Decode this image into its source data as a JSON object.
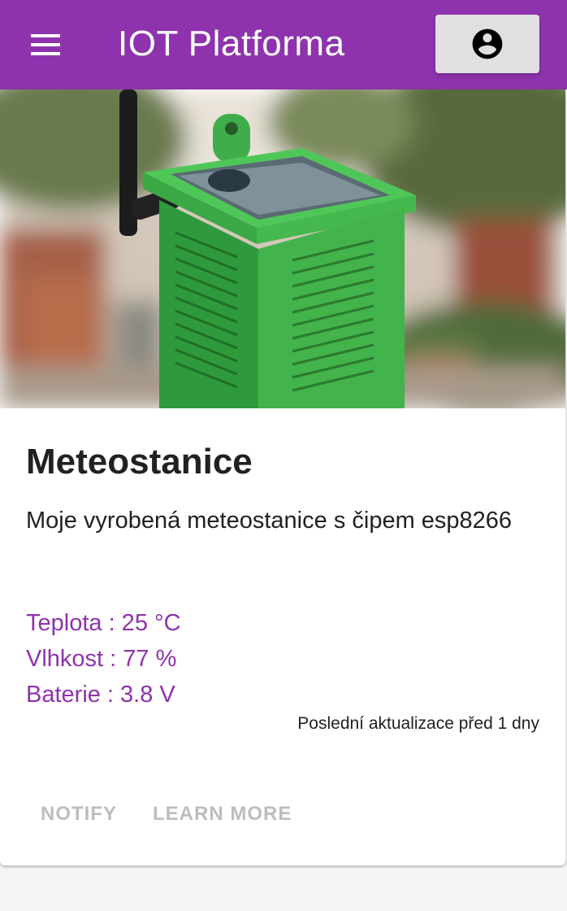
{
  "appbar": {
    "title": "IOT Platforma",
    "menu_icon": "menu-icon",
    "account_icon": "account-circle-icon",
    "color": "#8e33ad"
  },
  "card": {
    "image_description_icon": "weather-station-photo",
    "title": "Meteostanice",
    "description": "Moje vyrobená meteostanice s čipem esp8266",
    "readings": [
      {
        "label": "Teplota : 25 °C"
      },
      {
        "label": "Vlhkost : 77 %"
      },
      {
        "label": "Baterie : 3.8 V"
      }
    ],
    "last_update": "Poslední aktualizace před 1 dny",
    "actions": {
      "notify": "NOTIFY",
      "learn_more": "LEARN MORE"
    },
    "accent_color": "#8e33ad"
  }
}
